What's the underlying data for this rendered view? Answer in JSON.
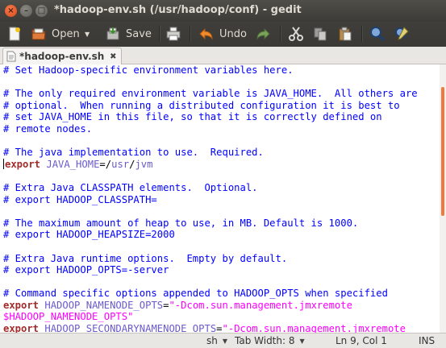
{
  "window": {
    "title": "*hadoop-env.sh (/usr/hadoop/conf) - gedit",
    "controls": [
      "×",
      "–",
      "□"
    ]
  },
  "toolbar": {
    "open_label": "Open",
    "save_label": "Save",
    "undo_label": "Undo"
  },
  "tab": {
    "label": "*hadoop-env.sh",
    "close": "✖"
  },
  "editor": {
    "lines": [
      [
        {
          "t": "cm",
          "v": "# Set Hadoop-specific environment variables here."
        }
      ],
      [
        {
          "t": "plain",
          "v": ""
        }
      ],
      [
        {
          "t": "cm",
          "v": "# The only required environment variable is JAVA_HOME.  All others are"
        }
      ],
      [
        {
          "t": "cm",
          "v": "# optional.  When running a distributed configuration it is best to"
        }
      ],
      [
        {
          "t": "cm",
          "v": "# set JAVA_HOME in this file, so that it is correctly defined on"
        }
      ],
      [
        {
          "t": "cm",
          "v": "# remote nodes."
        }
      ],
      [
        {
          "t": "plain",
          "v": ""
        }
      ],
      [
        {
          "t": "cm",
          "v": "# The java implementation to use.  Required."
        }
      ],
      [
        {
          "t": "caret",
          "v": ""
        },
        {
          "t": "kw",
          "v": "export"
        },
        {
          "t": "plain",
          "v": " "
        },
        {
          "t": "var",
          "v": "JAVA_HOME"
        },
        {
          "t": "plain",
          "v": "=/"
        },
        {
          "t": "var",
          "v": "usr"
        },
        {
          "t": "plain",
          "v": "/"
        },
        {
          "t": "var",
          "v": "jvm"
        }
      ],
      [
        {
          "t": "plain",
          "v": ""
        }
      ],
      [
        {
          "t": "cm",
          "v": "# Extra Java CLASSPATH elements.  Optional."
        }
      ],
      [
        {
          "t": "cm",
          "v": "# export HADOOP_CLASSPATH="
        }
      ],
      [
        {
          "t": "plain",
          "v": ""
        }
      ],
      [
        {
          "t": "cm",
          "v": "# The maximum amount of heap to use, in MB. Default is 1000."
        }
      ],
      [
        {
          "t": "cm",
          "v": "# export HADOOP_HEAPSIZE=2000"
        }
      ],
      [
        {
          "t": "plain",
          "v": ""
        }
      ],
      [
        {
          "t": "cm",
          "v": "# Extra Java runtime options.  Empty by default."
        }
      ],
      [
        {
          "t": "cm",
          "v": "# export HADOOP_OPTS=-server"
        }
      ],
      [
        {
          "t": "plain",
          "v": ""
        }
      ],
      [
        {
          "t": "cm",
          "v": "# Command specific options appended to HADOOP_OPTS when specified"
        }
      ],
      [
        {
          "t": "kw",
          "v": "export"
        },
        {
          "t": "plain",
          "v": " "
        },
        {
          "t": "var",
          "v": "HADOOP_NAMENODE_OPTS"
        },
        {
          "t": "plain",
          "v": "="
        },
        {
          "t": "str",
          "v": "\"-Dcom.sun.management.jmxremote"
        }
      ],
      [
        {
          "t": "str",
          "v": "$HADOOP_NAMENODE_OPTS\""
        }
      ],
      [
        {
          "t": "kw",
          "v": "export"
        },
        {
          "t": "plain",
          "v": " "
        },
        {
          "t": "var",
          "v": "HADOOP_SECONDARYNAMENODE_OPTS"
        },
        {
          "t": "plain",
          "v": "="
        },
        {
          "t": "str",
          "v": "\"-Dcom.sun.management.jmxremote"
        }
      ]
    ]
  },
  "statusbar": {
    "language": "sh",
    "tab_width": "Tab Width: 8",
    "position": "Ln 9, Col 1",
    "mode": "INS"
  },
  "icons": {
    "new": "new-document-icon",
    "open": "open-folder-icon",
    "save": "save-icon",
    "print": "print-icon",
    "undo": "undo-icon",
    "redo": "redo-icon",
    "cut": "cut-icon",
    "copy": "copy-icon",
    "paste": "paste-icon",
    "find": "find-icon",
    "replace": "find-replace-icon"
  },
  "colors": {
    "comment": "#0000ff",
    "keyword": "#a52a2a",
    "variable": "#6a5acd",
    "string": "#ff00ff",
    "titlebar": "#3c3b37",
    "accent": "#ef7a3f"
  }
}
